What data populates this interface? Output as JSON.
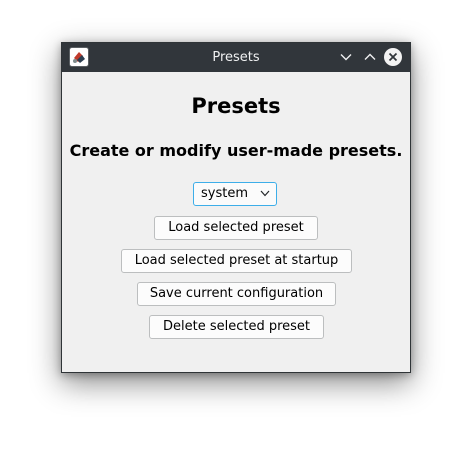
{
  "window": {
    "title": "Presets",
    "icons": {
      "app": "app-logo-icon",
      "minimize": "chevron-down-icon",
      "maximize": "chevron-up-icon",
      "close": "close-icon"
    }
  },
  "main": {
    "heading": "Presets",
    "subheading": "Create or modify user-made presets.",
    "preset_select": {
      "selected": "system"
    },
    "buttons": {
      "load": "Load selected preset",
      "load_startup": "Load selected preset at startup",
      "save": "Save current configuration",
      "delete": "Delete selected preset"
    }
  },
  "colors": {
    "titlebar": "#31363b",
    "window_bg": "#f0f0f0",
    "focus_accent": "#3daee9"
  }
}
